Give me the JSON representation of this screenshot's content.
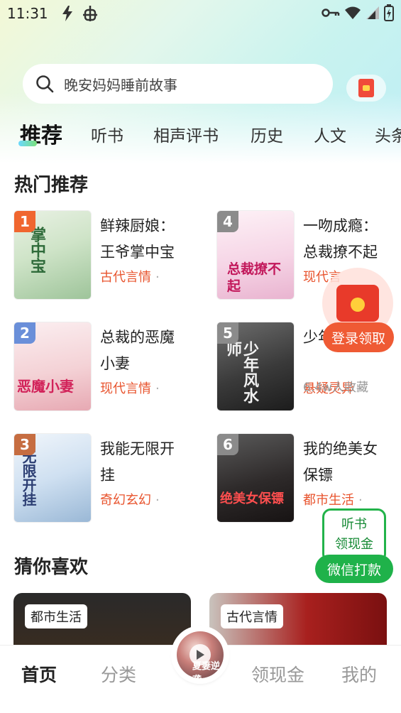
{
  "status_bar": {
    "time": "11:31",
    "left_icons": [
      "flash-icon",
      "bug-icon"
    ],
    "right_icons": [
      "key-icon",
      "wifi-icon",
      "signal-icon",
      "battery-icon"
    ]
  },
  "search": {
    "placeholder": "晚安妈妈睡前故事"
  },
  "tabs": [
    {
      "label": "推荐",
      "active": true
    },
    {
      "label": "听书"
    },
    {
      "label": "相声评书"
    },
    {
      "label": "历史"
    },
    {
      "label": "人文"
    },
    {
      "label": "头条"
    }
  ],
  "hot": {
    "title": "热门推荐",
    "books": [
      {
        "rank": "1",
        "title": "鲜辣厨娘：王爷掌中宝",
        "genre": "古代言情",
        "meta": "",
        "cover_text": "掌中宝"
      },
      {
        "rank": "2",
        "title": "总裁的恶魔小妻",
        "genre": "现代言情",
        "meta": "",
        "cover_text": "恶魔小妻"
      },
      {
        "rank": "3",
        "title": "我能无限开挂",
        "genre": "奇幻玄幻",
        "meta": "",
        "cover_text": "无限开挂"
      },
      {
        "rank": "4",
        "title": "一吻成瘾：总裁撩不起",
        "genre": "现代言",
        "meta": "",
        "cover_text": "总裁撩不起"
      },
      {
        "rank": "5",
        "title": "少年",
        "genre": "悬疑灵异",
        "meta": "6.4w人收藏",
        "cover_text": "少年风水师"
      },
      {
        "rank": "6",
        "title": "我的绝美女保镖",
        "genre": "都市生活",
        "meta": "",
        "cover_text": "绝美女保镖"
      }
    ]
  },
  "floating": {
    "login_label": "登录领取",
    "wechat_line1": "听书",
    "wechat_line2": "领现金",
    "wechat_pill": "微信打款"
  },
  "guess": {
    "title": "猜你喜欢",
    "cards": [
      {
        "tag": "都市生活"
      },
      {
        "tag": "古代言情"
      }
    ]
  },
  "bottom_nav": {
    "items": [
      {
        "label": "首页",
        "active": true
      },
      {
        "label": "分类"
      },
      {
        "label": "领现金"
      },
      {
        "label": "我的"
      }
    ],
    "center_cover_text": "夏妻逆袭"
  },
  "colors": {
    "accent_red": "#e8542e",
    "accent_green": "#1fb24a",
    "rank_1": "#f0662f",
    "rank_2": "#6a8fd9",
    "rank_3": "#c66d41",
    "rank_gray": "#8b8b8b"
  }
}
